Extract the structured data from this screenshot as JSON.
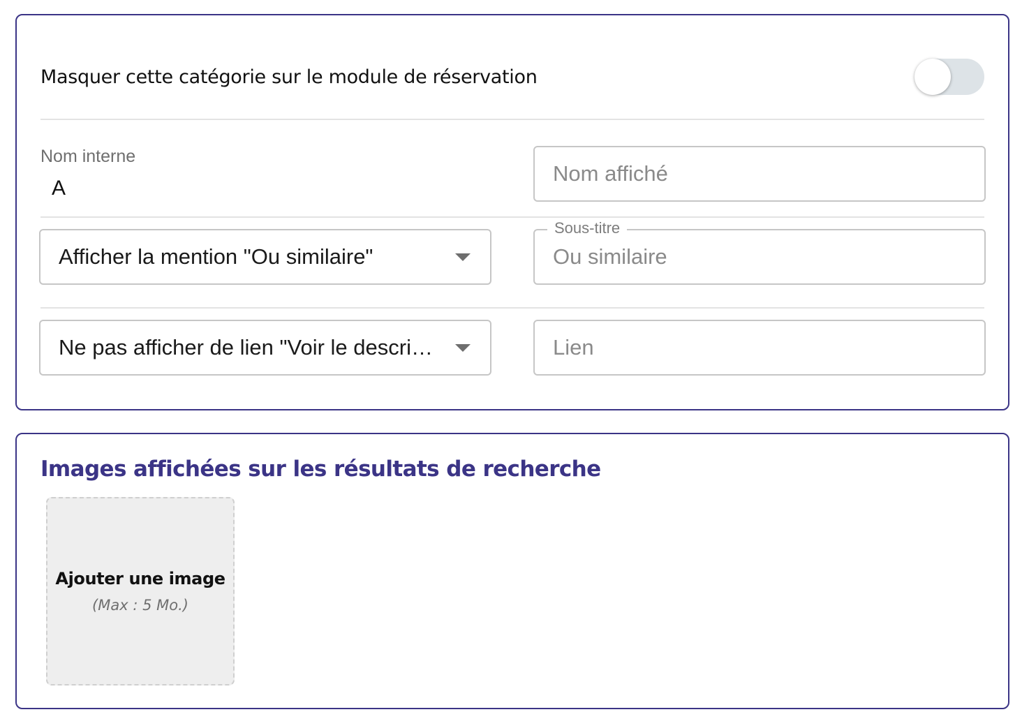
{
  "settings": {
    "hide_category_label": "Masquer cette catégorie sur le module de réservation",
    "hide_category_enabled": false,
    "internal_name": {
      "label": "Nom interne",
      "value": "A"
    },
    "display_name": {
      "placeholder": "Nom affiché",
      "value": ""
    },
    "similar_mention_select": {
      "selected": "Afficher la mention \"Ou similaire\""
    },
    "subtitle": {
      "label": "Sous-titre",
      "placeholder": "Ou similaire",
      "value": ""
    },
    "description_link_select": {
      "selected": "Ne pas afficher de lien \"Voir le descriptif\""
    },
    "link": {
      "placeholder": "Lien",
      "value": ""
    }
  },
  "images": {
    "title": "Images affichées sur les résultats de recherche",
    "add_image_label": "Ajouter une image",
    "add_image_hint": "(Max : 5 Mo.)"
  },
  "colors": {
    "accent": "#3b3486",
    "border": "#c6c6c6",
    "toggle_off": "#dde3e7",
    "upload_bg": "#eeeeee"
  }
}
